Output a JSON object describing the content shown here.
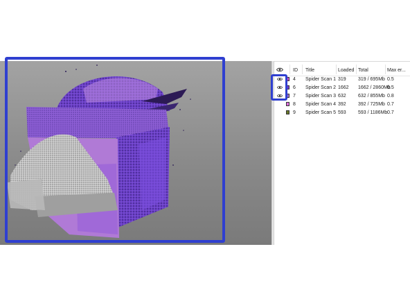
{
  "table": {
    "headers": {
      "visible_icon": "eye-icon",
      "id": "ID",
      "title": "Title",
      "loaded": "Loaded",
      "total": "Total",
      "max_error": "Max er..."
    },
    "rows": [
      {
        "visible": true,
        "color": "#cc55cc",
        "id": "4",
        "title": "Spider Scan 1",
        "loaded": "319",
        "total": "319 / 695Mb",
        "max_error": "0.5"
      },
      {
        "visible": true,
        "color": "#7a3fd0",
        "id": "6",
        "title": "Spider Scan 2",
        "loaded": "1662",
        "total": "1662 / 2860Mb",
        "max_error": "0.5"
      },
      {
        "visible": true,
        "color": "#9a6fd8",
        "id": "7",
        "title": "Spider Scan 3",
        "loaded": "632",
        "total": "632 / 855Mb",
        "max_error": "0.8"
      },
      {
        "visible": false,
        "color": "#e070e0",
        "id": "8",
        "title": "Spider Scan 4",
        "loaded": "392",
        "total": "392 / 725Mb",
        "max_error": "0.7"
      },
      {
        "visible": false,
        "color": "#6b7a2a",
        "id": "9",
        "title": "Spider Scan 5",
        "loaded": "593",
        "total": "593 / 1186Mb",
        "max_error": "0.7"
      }
    ]
  },
  "colors": {
    "highlight": "#2f3fd0",
    "viewport_bg_top": "#a3a3a3",
    "viewport_bg_bottom": "#7a7a7a"
  }
}
